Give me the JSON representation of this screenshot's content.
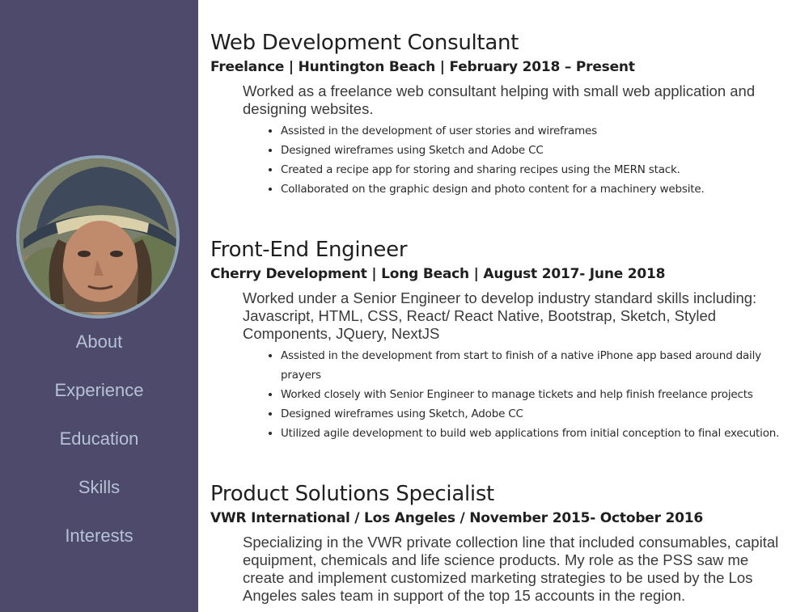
{
  "sidebar": {
    "nav": [
      {
        "label": "About"
      },
      {
        "label": "Experience"
      },
      {
        "label": "Education"
      },
      {
        "label": "Skills"
      },
      {
        "label": "Interests"
      }
    ]
  },
  "jobs": [
    {
      "title": "Web Development Consultant",
      "meta": "Freelance | Huntington Beach | February 2018 – Present",
      "description": "Worked as a freelance web consultant helping with small web application and designing websites.",
      "bullets": [
        "Assisted in the development of user stories and wireframes",
        "Designed wireframes using Sketch and Adobe CC",
        "Created a recipe app for storing and sharing recipes using the MERN stack.",
        "Collaborated on the graphic design and photo content for a machinery website."
      ]
    },
    {
      "title": "Front-End Engineer",
      "meta": "Cherry Development | Long Beach | August 2017- June 2018",
      "description": "Worked under a Senior Engineer to develop industry standard skills including: Javascript, HTML, CSS, React/ React Native, Bootstrap, Sketch, Styled Components, JQuery, NextJS",
      "bullets": [
        "Assisted in the development from start to finish of a native iPhone app based around daily prayers",
        "Worked closely with Senior Engineer to manage tickets and help finish freelance projects",
        "Designed wireframes using Sketch, Adobe CC",
        "Utilized agile development to build web applications from initial conception to final execution."
      ]
    },
    {
      "title": "Product Solutions Specialist",
      "meta": "VWR International / Los Angeles / November 2015- October 2016",
      "description": "Specializing in the VWR private collection line that included consumables, capital equipment, chemicals and life science products. My role as the PSS saw me create and implement customized marketing strategies to be used by the Los Angeles sales team in support of the top 15 accounts in the region.",
      "bullets": []
    }
  ],
  "colors": {
    "sidebar_bg": "#4d4a6c",
    "nav_text": "#b6c2d4",
    "avatar_border": "#8fa3b7"
  }
}
